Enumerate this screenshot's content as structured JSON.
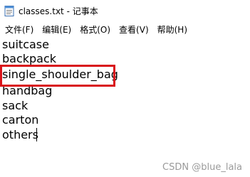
{
  "window": {
    "title": "classes.txt - 记事本"
  },
  "menubar": {
    "items": [
      {
        "label": "文件(F)"
      },
      {
        "label": "编辑(E)"
      },
      {
        "label": "格式(O)"
      },
      {
        "label": "查看(V)"
      },
      {
        "label": "帮助(H)"
      }
    ]
  },
  "editor": {
    "lines": [
      "suitcase",
      "backpack",
      "single_shoulder_bag",
      "handbag",
      "sack",
      "carton",
      "others"
    ],
    "highlighted_line_index": 2,
    "highlight_color": "#d9141a"
  },
  "watermark": {
    "text": "CSDN @blue_lala"
  }
}
